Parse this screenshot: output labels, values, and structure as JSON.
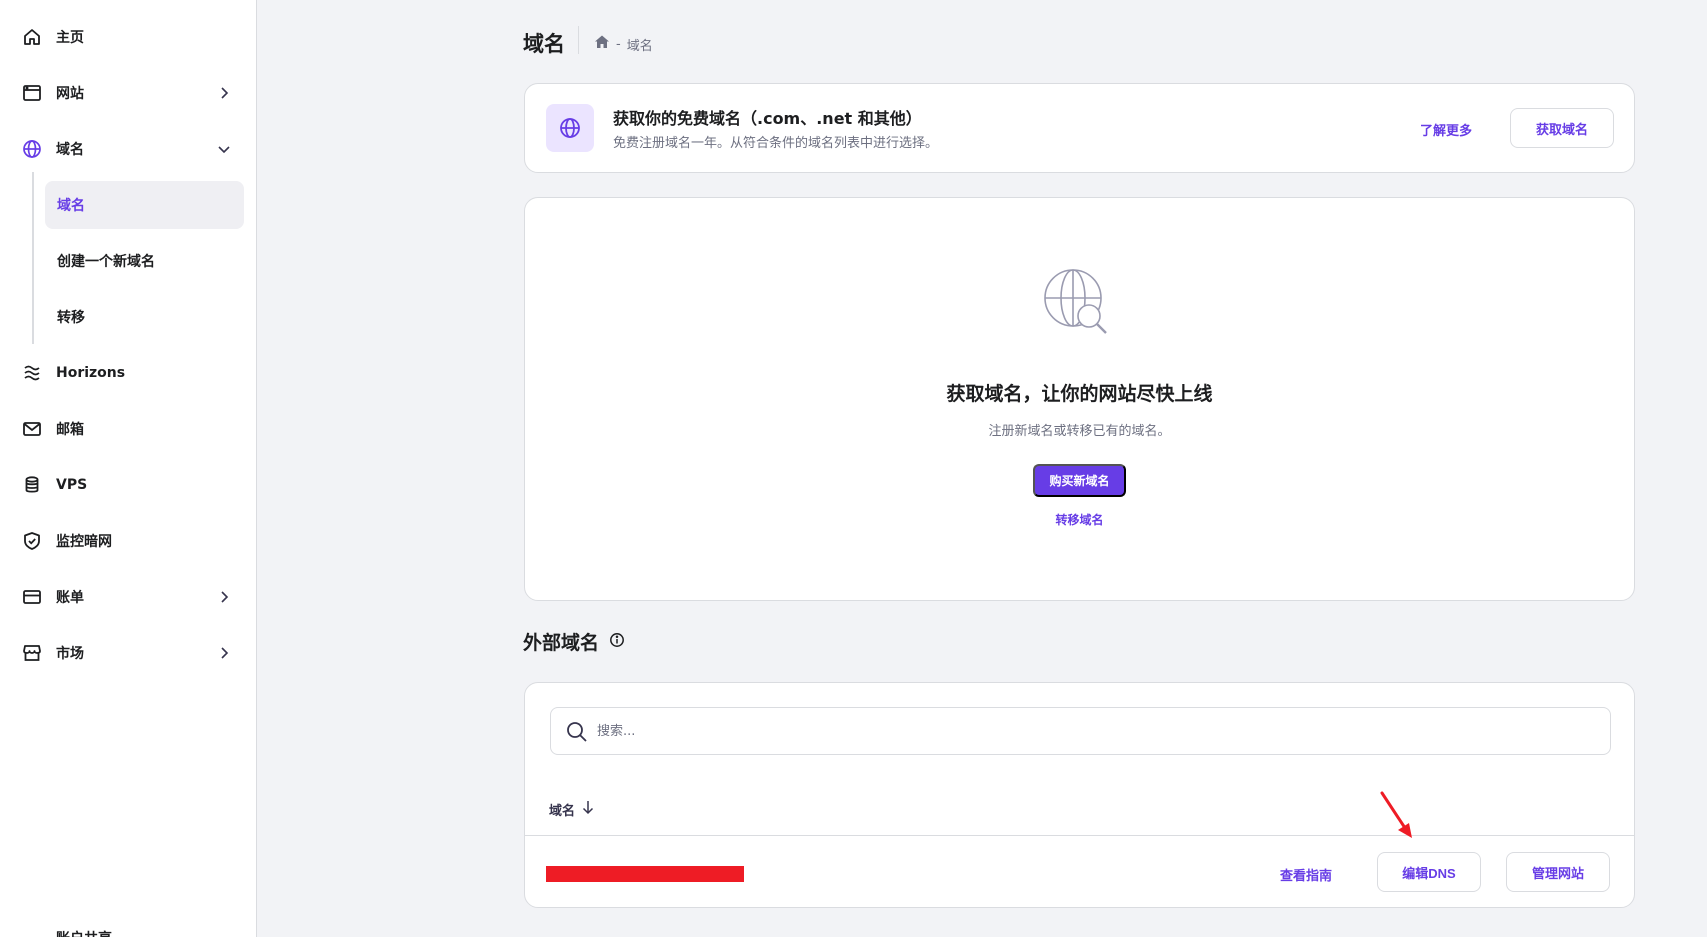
{
  "sidebar": {
    "items": [
      {
        "label": "主页",
        "icon": "home-icon"
      },
      {
        "label": "网站",
        "icon": "browser-window-icon"
      },
      {
        "label": "域名",
        "icon": "globe-icon"
      },
      {
        "label": "Horizons",
        "icon": "horizons-icon"
      },
      {
        "label": "邮箱",
        "icon": "mail-icon"
      },
      {
        "label": "VPS",
        "icon": "database-icon"
      },
      {
        "label": "监控暗网",
        "icon": "shield-check-icon"
      },
      {
        "label": "账单",
        "icon": "credit-card-icon"
      },
      {
        "label": "市场",
        "icon": "store-icon"
      }
    ],
    "subitems": [
      "域名",
      "创建一个新域名",
      "转移"
    ],
    "bottom_partial": "账户共享"
  },
  "header": {
    "title": "域名",
    "breadcrumb_sep": "-",
    "breadcrumb_current": "域名"
  },
  "promo": {
    "title": "获取你的免费域名（.com、.net 和其他）",
    "subtitle": "免费注册域名一年。从符合条件的域名列表中进行选择。",
    "learn_more": "了解更多",
    "get_domain": "获取域名"
  },
  "empty_state": {
    "title": "获取域名，让你的网站尽快上线",
    "subtitle": "注册新域名或转移已有的域名。",
    "buy_button": "购买新域名",
    "transfer_link": "转移域名"
  },
  "external": {
    "title": "外部域名",
    "search_placeholder": "搜索...",
    "column_header": "域名",
    "row_actions": {
      "guide": "查看指南",
      "edit_dns": "编辑DNS",
      "manage": "管理网站"
    }
  },
  "colors": {
    "accent": "#673de6",
    "annotation": "#ee1c25"
  }
}
